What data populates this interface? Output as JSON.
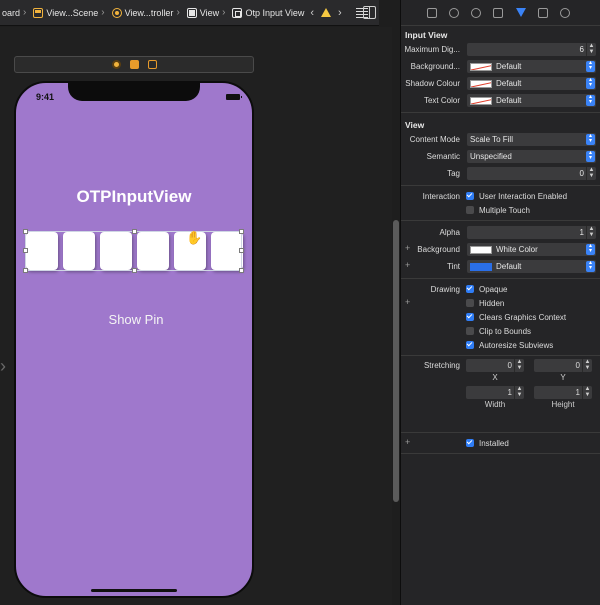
{
  "jumpbar": {
    "crumbs": [
      "oard",
      "View...Scene",
      "View...troller",
      "View",
      "Otp Input View"
    ]
  },
  "canvas": {
    "phone": {
      "time": "9:41",
      "title": "OTPInputView",
      "button": "Show Pin",
      "otp_box_count": 6,
      "background": "#9f78cc"
    }
  },
  "inspector": {
    "input_view": {
      "title": "Input View",
      "max_digits_label": "Maximum Dig...",
      "max_digits_value": "6",
      "background_label": "Background...",
      "background_value": "Default",
      "shadow_label": "Shadow Colour",
      "shadow_value": "Default",
      "text_color_label": "Text Color",
      "text_color_value": "Default"
    },
    "view": {
      "title": "View",
      "content_mode_label": "Content Mode",
      "content_mode_value": "Scale To Fill",
      "semantic_label": "Semantic",
      "semantic_value": "Unspecified",
      "tag_label": "Tag",
      "tag_value": "0",
      "interaction_label": "Interaction",
      "user_interaction": "User Interaction Enabled",
      "multiple_touch": "Multiple Touch",
      "alpha_label": "Alpha",
      "alpha_value": "1",
      "background_label": "Background",
      "background_value": "White Color",
      "tint_label": "Tint",
      "tint_value": "Default",
      "drawing_label": "Drawing",
      "opaque": "Opaque",
      "hidden": "Hidden",
      "clears_graphics": "Clears Graphics Context",
      "clip_to_bounds": "Clip to Bounds",
      "autoresize": "Autoresize Subviews",
      "stretching_label": "Stretching",
      "stretch_x": "0",
      "stretch_y": "0",
      "stretch_width": "1",
      "stretch_height": "1",
      "x_label": "X",
      "y_label": "Y",
      "width_label": "Width",
      "height_label": "Height",
      "installed": "Installed"
    }
  },
  "colors": {
    "accent": "#3a83f7",
    "phone_bg": "#9f78cc",
    "warning": "#f5c842"
  }
}
